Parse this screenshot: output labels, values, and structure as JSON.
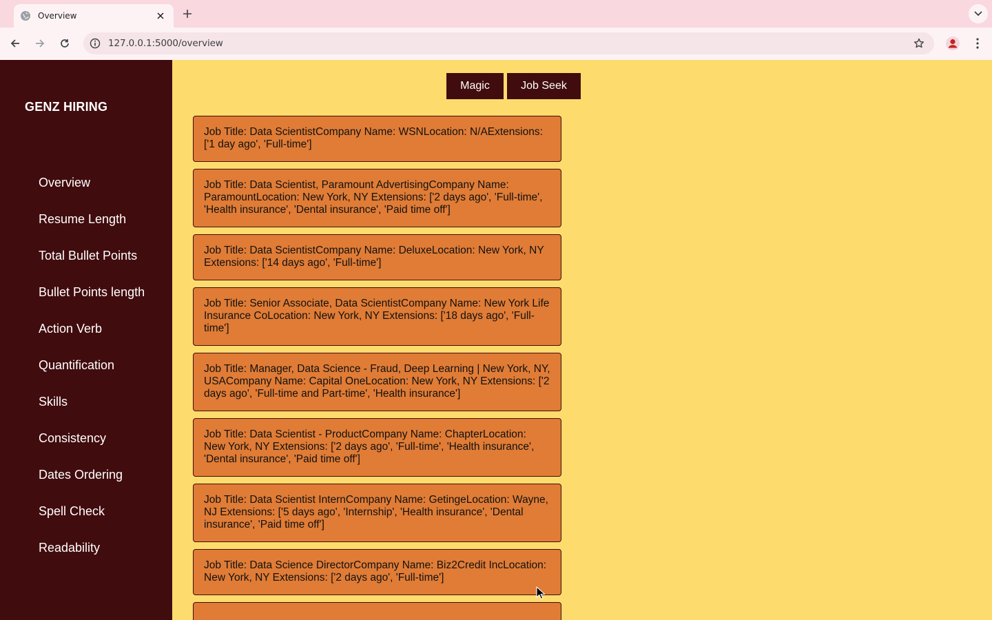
{
  "browser": {
    "tab_title": "Overview",
    "url": "127.0.0.1:5000/overview",
    "icons": [
      "globe-icon",
      "close-icon",
      "plus-icon",
      "chevron-down-icon",
      "back-arrow-icon",
      "forward-arrow-icon",
      "reload-icon",
      "info-icon",
      "star-icon",
      "profile-icon",
      "kebab-menu-icon"
    ]
  },
  "sidebar": {
    "brand": "GENZ HIRING",
    "items": [
      {
        "label": "Overview"
      },
      {
        "label": "Resume Length"
      },
      {
        "label": "Total Bullet Points"
      },
      {
        "label": "Bullet Points length"
      },
      {
        "label": "Action Verb"
      },
      {
        "label": "Quantification"
      },
      {
        "label": "Skills"
      },
      {
        "label": "Consistency"
      },
      {
        "label": "Dates Ordering"
      },
      {
        "label": "Spell Check"
      },
      {
        "label": "Readability"
      }
    ]
  },
  "buttons": {
    "magic": "Magic",
    "job_seek": "Job Seek"
  },
  "jobs": [
    {
      "text": "Job Title: Data ScientistCompany Name: WSNLocation: N/AExtensions: ['1 day ago', 'Full-time']"
    },
    {
      "text": "Job Title: Data Scientist, Paramount AdvertisingCompany Name: ParamountLocation: New York, NY Extensions: ['2 days ago', 'Full-time', 'Health insurance', 'Dental insurance', 'Paid time off']"
    },
    {
      "text": "Job Title: Data ScientistCompany Name: DeluxeLocation: New York, NY Extensions: ['14 days ago', 'Full-time']"
    },
    {
      "text": "Job Title: Senior Associate, Data ScientistCompany Name: New York Life Insurance CoLocation: New York, NY Extensions: ['18 days ago', 'Full-time']"
    },
    {
      "text": "Job Title: Manager, Data Science - Fraud, Deep Learning | New York, NY, USACompany Name: Capital OneLocation: New York, NY Extensions: ['2 days ago', 'Full-time and Part-time', 'Health insurance']"
    },
    {
      "text": "Job Title: Data Scientist - ProductCompany Name: ChapterLocation: New York, NY Extensions: ['2 days ago', 'Full-time', 'Health insurance', 'Dental insurance', 'Paid time off']"
    },
    {
      "text": "Job Title: Data Scientist InternCompany Name: GetingeLocation: Wayne, NJ Extensions: ['5 days ago', 'Internship', 'Health insurance', 'Dental insurance', 'Paid time off']"
    },
    {
      "text": "Job Title: Data Science DirectorCompany Name: Biz2Credit IncLocation: New York, NY Extensions: ['2 days ago', 'Full-time']"
    }
  ],
  "colors": {
    "sidebar_bg": "#410c0e",
    "content_bg": "#fddc6d",
    "card_bg": "#e07c36",
    "button_bg": "#410c0e"
  }
}
